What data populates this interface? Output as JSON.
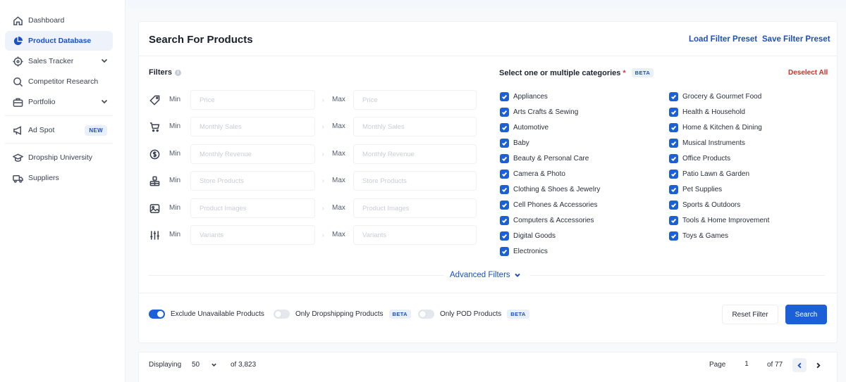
{
  "sidebar": {
    "items": [
      {
        "label": "Dashboard",
        "icon": "home-icon"
      },
      {
        "label": "Product Database",
        "icon": "pie-chart-icon",
        "active": true
      },
      {
        "label": "Sales Tracker",
        "icon": "target-icon",
        "expandable": true
      },
      {
        "label": "Competitor Research",
        "icon": "search-icon"
      },
      {
        "label": "Portfolio",
        "icon": "briefcase-icon",
        "expandable": true
      },
      {
        "label": "Ad Spot",
        "icon": "megaphone-icon",
        "badge": "NEW"
      },
      {
        "label": "Dropship University",
        "icon": "graduation-cap-icon"
      },
      {
        "label": "Suppliers",
        "icon": "truck-icon"
      }
    ]
  },
  "search": {
    "title": "Search For Products",
    "load_preset": "Load Filter Preset",
    "save_preset": "Save Filter Preset"
  },
  "filters": {
    "label": "Filters",
    "min_label": "Min",
    "max_label": "Max",
    "rows": [
      {
        "icon": "price-tag-icon",
        "placeholder": "Price"
      },
      {
        "icon": "cart-icon",
        "placeholder": "Monthly Sales"
      },
      {
        "icon": "dollar-circle-icon",
        "placeholder": "Monthly Revenue"
      },
      {
        "icon": "store-icon",
        "placeholder": "Store Products"
      },
      {
        "icon": "image-icon",
        "placeholder": "Product Images"
      },
      {
        "icon": "sliders-icon",
        "placeholder": "Variants"
      }
    ]
  },
  "categories": {
    "heading": "Select one or multiple categories",
    "required_mark": "*",
    "beta": "BETA",
    "deselect_all": "Deselect All",
    "left": [
      "Appliances",
      "Arts Crafts & Sewing",
      "Automotive",
      "Baby",
      "Beauty & Personal Care",
      "Camera & Photo",
      "Clothing & Shoes & Jewelry",
      "Cell Phones & Accessories",
      "Computers & Accessories",
      "Digital Goods",
      "Electronics"
    ],
    "right": [
      "Grocery & Gourmet Food",
      "Health & Household",
      "Home & Kitchen & Dining",
      "Musical Instruments",
      "Office Products",
      "Patio Lawn & Garden",
      "Pet Supplies",
      "Sports & Outdoors",
      "Tools & Home Improvement",
      "Toys & Games"
    ]
  },
  "advanced_filters": "Advanced Filters",
  "toggles": {
    "exclude_unavailable": {
      "label": "Exclude Unavailable Products",
      "on": true
    },
    "only_dropshipping": {
      "label": "Only Dropshipping Products",
      "badge": "BETA",
      "on": false
    },
    "only_pod": {
      "label": "Only POD Products",
      "badge": "BETA",
      "on": false
    }
  },
  "actions": {
    "reset": "Reset Filter",
    "search": "Search"
  },
  "pagination": {
    "displaying_label": "Displaying",
    "per_page": "50",
    "total": "of 3,823",
    "page_label": "Page",
    "page": "1",
    "of_pages": "of 77"
  },
  "colors": {
    "accent": "#1b5fd9",
    "link": "#1b4fc2",
    "danger": "#d42c2c"
  }
}
